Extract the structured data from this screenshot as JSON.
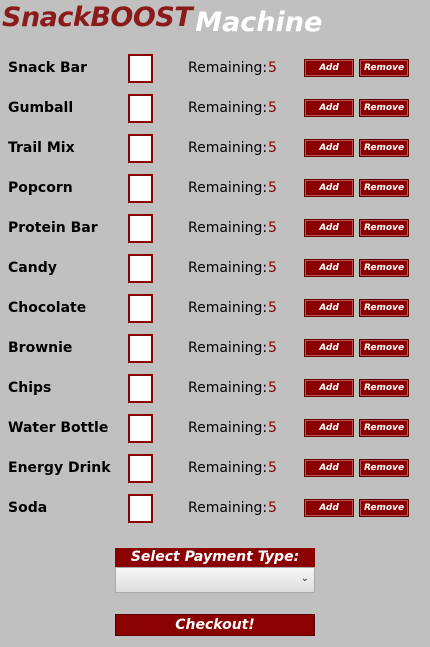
{
  "title": {
    "snack": "SnackBOOST",
    "machine": "Machine"
  },
  "remaining_label": "Remaining:",
  "add_label": "Add",
  "remove_label": "Remove",
  "items": [
    {
      "name": "Snack Bar",
      "remaining": "5"
    },
    {
      "name": "Gumball",
      "remaining": "5"
    },
    {
      "name": "Trail Mix",
      "remaining": "5"
    },
    {
      "name": "Popcorn",
      "remaining": "5"
    },
    {
      "name": "Protein Bar",
      "remaining": "5"
    },
    {
      "name": "Candy",
      "remaining": "5"
    },
    {
      "name": "Chocolate",
      "remaining": "5"
    },
    {
      "name": "Brownie",
      "remaining": "5"
    },
    {
      "name": "Chips",
      "remaining": "5"
    },
    {
      "name": "Water Bottle",
      "remaining": "5"
    },
    {
      "name": "Energy Drink",
      "remaining": "5"
    },
    {
      "name": "Soda",
      "remaining": "5"
    }
  ],
  "payment": {
    "label": "Select Payment Type:",
    "selected": ""
  },
  "checkout_label": "Checkout!",
  "colors": {
    "accent": "#8b0000",
    "background": "#c0c0c0"
  },
  "icons": {
    "select_arrow": "chevron-down-icon"
  }
}
